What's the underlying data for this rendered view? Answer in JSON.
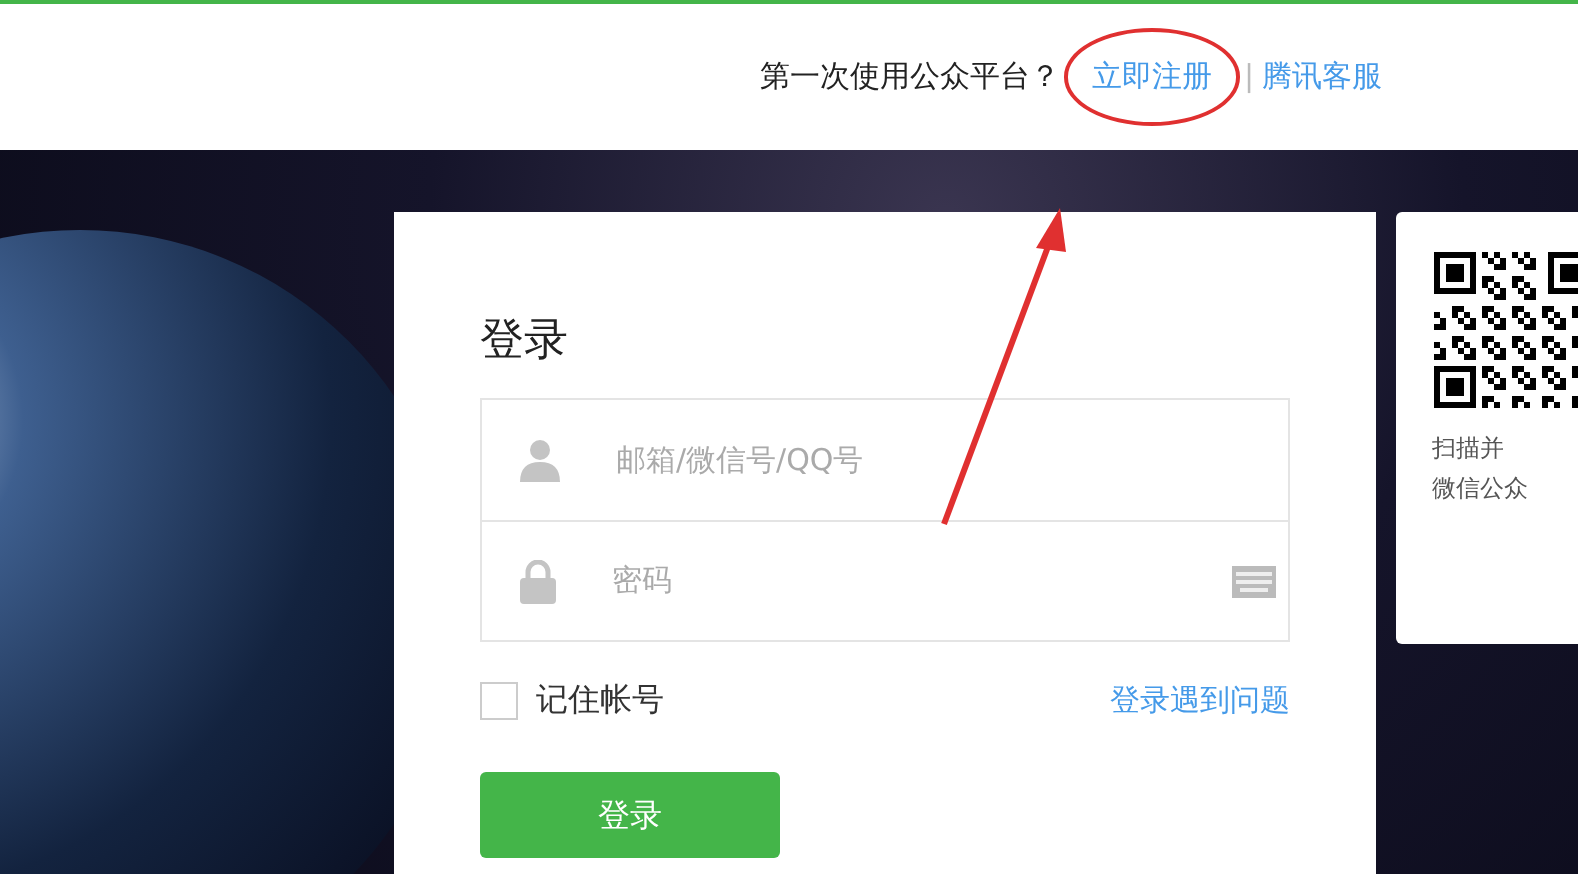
{
  "header": {
    "prompt": "第一次使用公众平台？",
    "register_link": "立即注册",
    "separator": "|",
    "support_link": "腾讯客服"
  },
  "login": {
    "title": "登录",
    "fields": [
      {
        "kind": "account",
        "placeholder": "邮箱/微信号/QQ号"
      },
      {
        "kind": "password",
        "placeholder": "密码"
      }
    ],
    "remember": {
      "label": "记住帐号",
      "checked": false
    },
    "help_link": "登录遇到问题",
    "submit": "登录"
  },
  "qr_panel": {
    "lines": [
      "扫描并",
      "微信公众"
    ]
  }
}
